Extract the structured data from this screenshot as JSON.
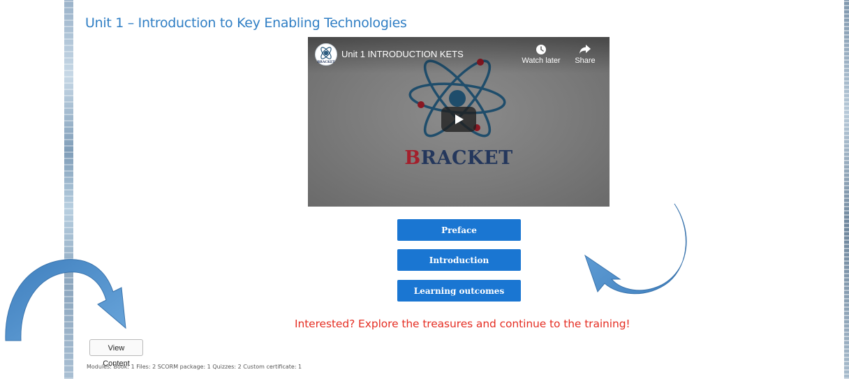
{
  "course": {
    "unit_title": "Unit 1 – Introduction to Key Enabling Technologies"
  },
  "video": {
    "title": "Unit 1 INTRODUCTION KETS",
    "watch_later_label": "Watch later",
    "share_label": "Share",
    "brand_first_letter": "B",
    "brand_rest": "RACKET",
    "channel_avatar_text": "BRACKET"
  },
  "nav_buttons": {
    "preface": "Preface",
    "introduction": "Introduction",
    "learning_outcomes": "Learning outcomes"
  },
  "cta_text": "Interested? Explore the treasures and continue to the training!",
  "view_content_label": "View Content",
  "modules_summary": "Modules: Book: 1 Files: 2 SCORM package: 1 Quizzes: 2 Custom certificate: 1",
  "icons": {
    "left_arrow": "curved-arrow-down-right-icon",
    "right_arrow": "curved-arrow-down-left-icon",
    "watch_later": "clock-icon",
    "share": "share-arrow-icon",
    "play": "play-icon",
    "logo": "atom-logo-icon"
  },
  "colors": {
    "title_blue": "#2f7ec4",
    "button_blue": "#1a76d2",
    "cta_red": "#e52e23",
    "arrow_blue": "#4f8fcb",
    "brand_navy": "#24375c",
    "brand_red": "#a31f2c"
  }
}
